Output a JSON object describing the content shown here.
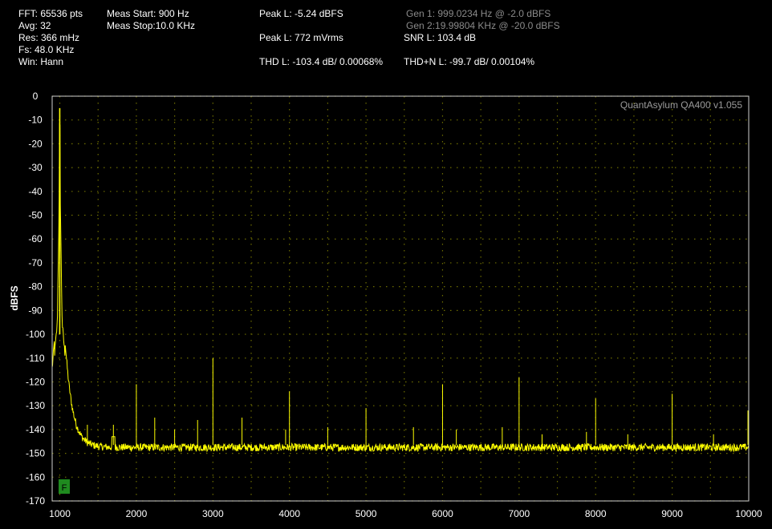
{
  "info": {
    "fft": "FFT: 65536 pts",
    "avg": "Avg: 32",
    "res": "Res: 366 mHz",
    "fs": "Fs: 48.0 KHz",
    "win": "Win: Hann",
    "meas_start": "Meas Start: 900 Hz",
    "meas_stop": "Meas Stop:10.0 KHz",
    "peak_dbfs": "Peak L: -5.24 dBFS",
    "peak_vrms": "Peak L: 772 mVrms",
    "thd": "THD L: -103.4 dB/ 0.00068%",
    "gen1": "Gen 1: 999.0234 Hz @ -2.0  dBFS",
    "gen2": "Gen 2:19.99804 KHz @ -20.0  dBFS",
    "snr": "SNR L: 103.4 dB",
    "thdn": "THD+N L: -99.7 dB/ 0.00104%"
  },
  "plot": {
    "watermark": "QuantAsylum QA400 v1.055",
    "marker_label": "F",
    "bg": "#000000",
    "grid_color": "#6e6e00",
    "trace_color": "#ffff00",
    "border_color": "#cfcfcf",
    "marker_color": "#1f8a1f"
  },
  "chart_data": {
    "type": "line",
    "title": "",
    "xlabel": "",
    "ylabel": "dBFS",
    "xlim": [
      900,
      10000
    ],
    "ylim": [
      -170,
      0
    ],
    "grid": true,
    "x_ticks": [
      1000,
      2000,
      3000,
      4000,
      5000,
      6000,
      7000,
      8000,
      9000,
      10000
    ],
    "y_ticks": [
      0,
      -10,
      -20,
      -30,
      -40,
      -50,
      -60,
      -70,
      -80,
      -90,
      -100,
      -110,
      -120,
      -130,
      -140,
      -150,
      -160,
      -170
    ],
    "noise_floor": -147.5,
    "fundamental": {
      "x": 999,
      "y": -5
    },
    "spurs": [
      {
        "x": 1360,
        "y": -138
      },
      {
        "x": 1700,
        "y": -138
      },
      {
        "x": 2000,
        "y": -121
      },
      {
        "x": 2240,
        "y": -135
      },
      {
        "x": 2500,
        "y": -140
      },
      {
        "x": 2800,
        "y": -136
      },
      {
        "x": 3000,
        "y": -110
      },
      {
        "x": 3380,
        "y": -135
      },
      {
        "x": 3950,
        "y": -140
      },
      {
        "x": 4000,
        "y": -124
      },
      {
        "x": 4500,
        "y": -139
      },
      {
        "x": 5000,
        "y": -131
      },
      {
        "x": 5620,
        "y": -139
      },
      {
        "x": 6000,
        "y": -121
      },
      {
        "x": 6180,
        "y": -140
      },
      {
        "x": 6780,
        "y": -139
      },
      {
        "x": 7000,
        "y": -118
      },
      {
        "x": 7300,
        "y": -142
      },
      {
        "x": 7880,
        "y": -141
      },
      {
        "x": 8000,
        "y": -127
      },
      {
        "x": 8420,
        "y": -142
      },
      {
        "x": 9000,
        "y": -125
      },
      {
        "x": 9540,
        "y": -142
      },
      {
        "x": 9990,
        "y": -132
      }
    ]
  }
}
